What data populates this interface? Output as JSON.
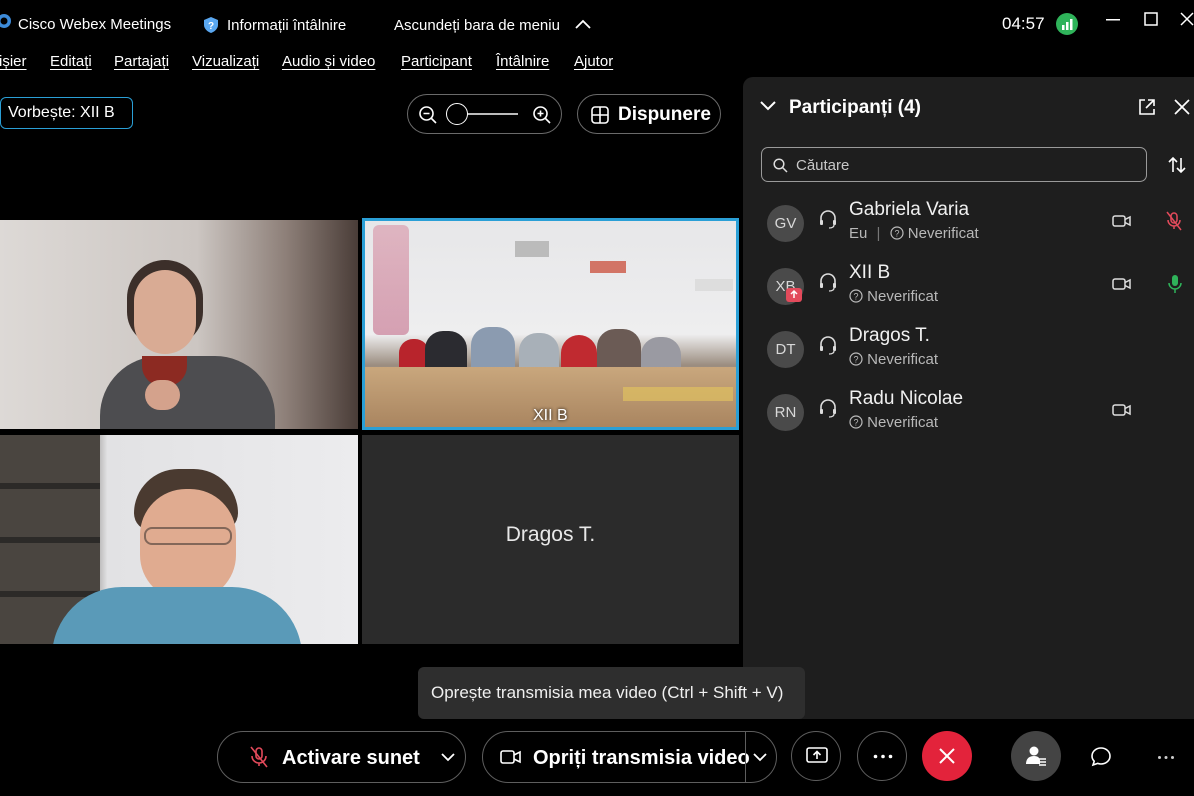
{
  "titlebar": {
    "app_name": "Cisco Webex Meetings",
    "meeting_info": "Informații întâlnire",
    "hide_menu": "Ascundeți bara de meniu",
    "clock": "04:57"
  },
  "menubar": {
    "items": [
      "Fișier",
      "Editați",
      "Partajați",
      "Vizualizați",
      "Audio și video",
      "Participant",
      "Întâlnire",
      "Ajutor"
    ],
    "first_visible": "ișier"
  },
  "toolbar": {
    "speaker_label": "Vorbește: XII B",
    "zoom_level_fraction": 0.0,
    "layout_label": "Dispunere"
  },
  "video_grid": {
    "tiles": [
      {
        "id": "gabriela",
        "label": ""
      },
      {
        "id": "xiib",
        "label": "XII B",
        "active_speaker": true
      },
      {
        "id": "radu",
        "label": ""
      },
      {
        "id": "dragos",
        "label": "Dragos T."
      }
    ]
  },
  "participants_panel": {
    "title": "Participanți (4)",
    "search_placeholder": "Căutare",
    "participants": [
      {
        "initials": "GV",
        "name": "Gabriela Varia",
        "status_prefix": "Eu",
        "status": "Neverificat",
        "video": true,
        "mic": "muted"
      },
      {
        "initials": "XB",
        "name": "XII B",
        "status_prefix": "",
        "status": "Neverificat",
        "video": true,
        "mic": "active",
        "sharing": true
      },
      {
        "initials": "DT",
        "name": "Dragos T.",
        "status_prefix": "",
        "status": "Neverificat",
        "video": false,
        "mic": "none"
      },
      {
        "initials": "RN",
        "name": "Radu Nicolae",
        "status_prefix": "",
        "status": "Neverificat",
        "video": true,
        "mic": "none"
      }
    ]
  },
  "tooltip": "Oprește transmisia mea video (Ctrl + Shift + V)",
  "controls": {
    "unmute_label": "Activare sunet",
    "stop_video_label": "Opriți transmisia video"
  },
  "colors": {
    "accent": "#2a9fd6",
    "end_call": "#e3233b",
    "mic_active": "#2fb35a",
    "mic_muted": "#e34a5b",
    "panel_bg": "#1e1e1e"
  }
}
